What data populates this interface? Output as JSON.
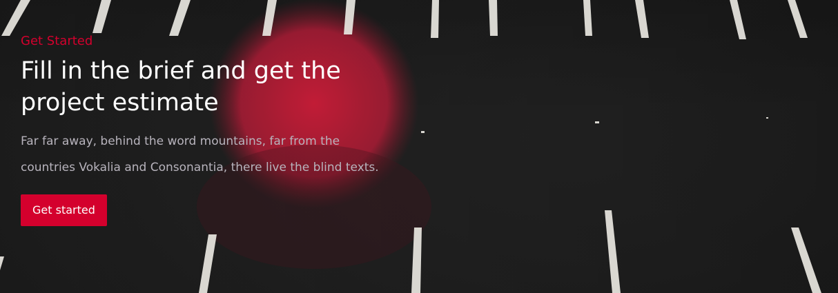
{
  "hero": {
    "eyebrow": "Get Started",
    "headline": "Fill in the brief and get the project estimate",
    "description": "Far far away, behind the word mountains, far from the countries Vokalia and Consonantia, there live the blind texts.",
    "cta_label": "Get started"
  },
  "colors": {
    "accent": "#d4002d",
    "headline": "#ffffff",
    "body_text": "#b8b4bd",
    "background": "#141414"
  },
  "background_image": {
    "subject": "asphalt-road-with-lane-markings",
    "overlay": "red-circle"
  }
}
